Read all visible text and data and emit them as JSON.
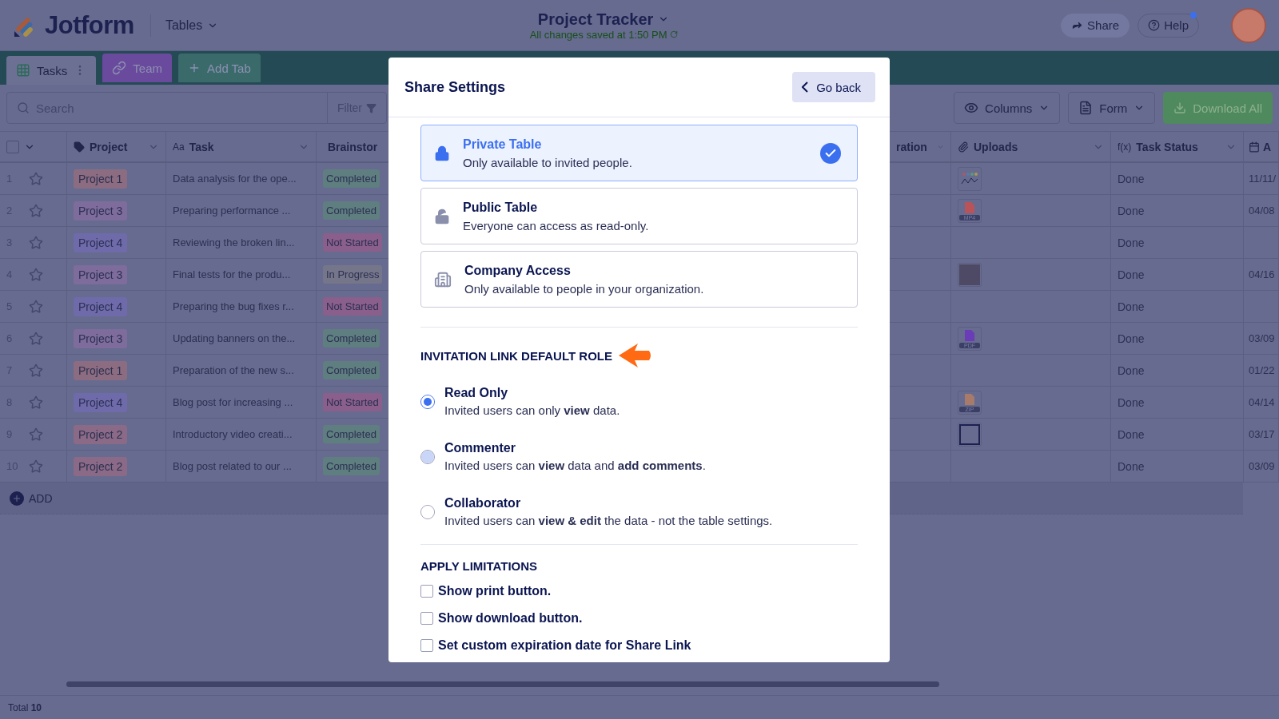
{
  "header": {
    "logo": "Jotform",
    "app_menu": "Tables",
    "title": "Project Tracker",
    "save_status": "All changes saved at 1:50 PM",
    "share": "Share",
    "help": "Help",
    "help_notification": true
  },
  "tabs": [
    {
      "label": "Tasks",
      "selected": true,
      "kind": "table"
    },
    {
      "label": "Team",
      "selected": false,
      "kind": "link"
    },
    {
      "label": "Add Tab",
      "selected": false,
      "kind": "add"
    }
  ],
  "toolbar": {
    "search_placeholder": "Search",
    "filter": "Filter",
    "columns": "Columns",
    "form": "Form",
    "download": "Download All"
  },
  "table": {
    "select_all_checked": false,
    "columns": [
      {
        "label": "Project",
        "kind": "tag",
        "chevron": true
      },
      {
        "label": "Task",
        "kind": "text",
        "type_label": "Aa",
        "chevron": true
      },
      {
        "label": "Brainstor",
        "kind": "tag"
      },
      {
        "label": "ration",
        "kind": "plain",
        "chevron": true
      },
      {
        "label": "Uploads",
        "kind": "clip",
        "chevron": true
      },
      {
        "label": "Task Status",
        "kind": "formula",
        "type_label": "f(x)",
        "chevron": true
      },
      {
        "label": "A",
        "kind": "calendar"
      }
    ],
    "rows": [
      {
        "num": "1",
        "starred": false,
        "project": {
          "label": "Project 1",
          "color": "#8c6c80"
        },
        "task": "Data analysis for the ope...",
        "status": {
          "label": "Completed",
          "color": "#5e7e80"
        },
        "upload": {
          "kind": "chart"
        },
        "task_status": "Done",
        "date": "11/11/"
      },
      {
        "num": "2",
        "starred": false,
        "project": {
          "label": "Project 3",
          "color": "#7e6c9c"
        },
        "task": "Preparing performance ...",
        "status": {
          "label": "Completed",
          "color": "#5e7e80"
        },
        "upload": {
          "kind": "file",
          "label": "MP4",
          "color": "#b9535a"
        },
        "task_status": "Done",
        "date": "04/08"
      },
      {
        "num": "3",
        "starred": false,
        "project": {
          "label": "Project 4",
          "color": "#6f6aaa"
        },
        "task": "Reviewing the broken lin...",
        "status": {
          "label": "Not Started",
          "color": "#8a5f8c"
        },
        "task_status": "Done"
      },
      {
        "num": "4",
        "starred": false,
        "project": {
          "label": "Project 3",
          "color": "#7e6c9c"
        },
        "task": "Final tests for the produ...",
        "status": {
          "label": "In Progress",
          "color": "#76768a"
        },
        "upload": {
          "kind": "photo"
        },
        "task_status": "Done",
        "date": "04/16"
      },
      {
        "num": "5",
        "starred": false,
        "project": {
          "label": "Project 4",
          "color": "#6f6aaa"
        },
        "task": "Preparing the bug fixes r...",
        "status": {
          "label": "Not Started",
          "color": "#8a5f8c"
        },
        "task_status": "Done"
      },
      {
        "num": "6",
        "starred": false,
        "project": {
          "label": "Project 3",
          "color": "#7e6c9c"
        },
        "task": "Updating banners on the...",
        "status": {
          "label": "Completed",
          "color": "#5e7e80"
        },
        "upload": {
          "kind": "file",
          "label": "PDF",
          "color": "#6a3cb8"
        },
        "task_status": "Done",
        "date": "03/09"
      },
      {
        "num": "7",
        "starred": false,
        "project": {
          "label": "Project 1",
          "color": "#8c6c80"
        },
        "task": "Preparation of the new s...",
        "status": {
          "label": "Completed",
          "color": "#5e7e80"
        },
        "task_status": "Done",
        "date": "01/22"
      },
      {
        "num": "8",
        "starred": false,
        "project": {
          "label": "Project 4",
          "color": "#6f6aaa"
        },
        "task": "Blog post for increasing ...",
        "status": {
          "label": "Not Started",
          "color": "#8a5f8c"
        },
        "upload": {
          "kind": "file",
          "label": "ZIP",
          "color": "#a87a6a"
        },
        "task_status": "Done",
        "date": "04/14"
      },
      {
        "num": "9",
        "starred": false,
        "project": {
          "label": "Project 2",
          "color": "#8a6a86"
        },
        "task": "Introductory video creati...",
        "status": {
          "label": "Completed",
          "color": "#5e7e80"
        },
        "upload": {
          "kind": "document"
        },
        "task_status": "Done",
        "date": "03/17"
      },
      {
        "num": "10",
        "starred": false,
        "project": {
          "label": "Project 2",
          "color": "#8a6a86"
        },
        "task": "Blog post related to our ...",
        "status": {
          "label": "Completed",
          "color": "#5e7e80"
        },
        "task_status": "Done",
        "date": "03/09"
      }
    ],
    "add": "ADD",
    "total": "Total **10**"
  },
  "modal": {
    "title": "Share Settings",
    "back": "Go back",
    "access_options": [
      {
        "kind": "private",
        "title": "Private Table",
        "description": "Only available to invited people.",
        "selected": true
      },
      {
        "kind": "public",
        "title": "Public Table",
        "description": "Everyone can access as read-only.",
        "selected": false
      },
      {
        "kind": "company",
        "title": "Company Access",
        "description": "Only available to people in your organization.",
        "selected": false
      }
    ],
    "role_heading": "INVITATION LINK DEFAULT ROLE",
    "roles": [
      {
        "label": "Read Only",
        "description": "Invited users can only **view** data.",
        "selected": true,
        "dimmed": false
      },
      {
        "label": "Commenter",
        "description": "Invited users can **view** data and **add comments**.",
        "selected": false,
        "dimmed": true
      },
      {
        "label": "Collaborator",
        "description": "Invited users can **view & edit** the data - not the table settings.",
        "selected": false,
        "dimmed": false
      }
    ],
    "limits_heading": "APPLY LIMITATIONS",
    "limits": [
      {
        "label": "Show print button.",
        "checked": false
      },
      {
        "label": "Show download button.",
        "checked": false
      },
      {
        "label": "Set custom expiration date for Share Link",
        "checked": false
      }
    ]
  }
}
